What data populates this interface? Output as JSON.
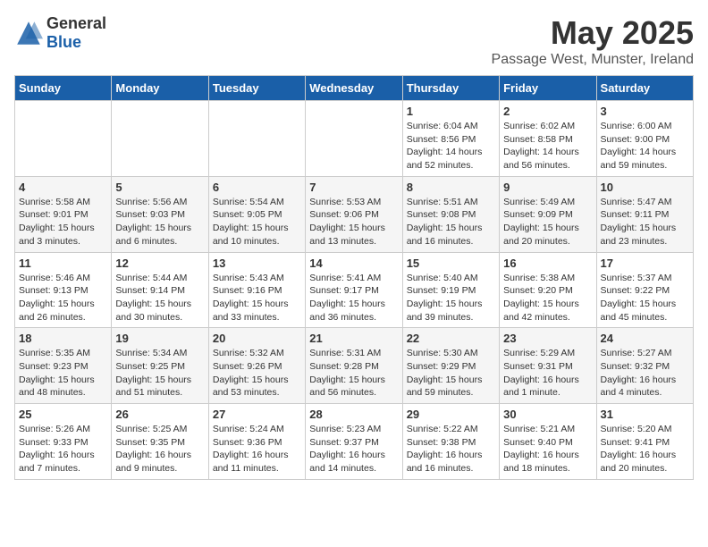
{
  "logo": {
    "general": "General",
    "blue": "Blue"
  },
  "title": "May 2025",
  "location": "Passage West, Munster, Ireland",
  "days_of_week": [
    "Sunday",
    "Monday",
    "Tuesday",
    "Wednesday",
    "Thursday",
    "Friday",
    "Saturday"
  ],
  "weeks": [
    [
      {
        "day": "",
        "info": ""
      },
      {
        "day": "",
        "info": ""
      },
      {
        "day": "",
        "info": ""
      },
      {
        "day": "",
        "info": ""
      },
      {
        "day": "1",
        "info": "Sunrise: 6:04 AM\nSunset: 8:56 PM\nDaylight: 14 hours\nand 52 minutes."
      },
      {
        "day": "2",
        "info": "Sunrise: 6:02 AM\nSunset: 8:58 PM\nDaylight: 14 hours\nand 56 minutes."
      },
      {
        "day": "3",
        "info": "Sunrise: 6:00 AM\nSunset: 9:00 PM\nDaylight: 14 hours\nand 59 minutes."
      }
    ],
    [
      {
        "day": "4",
        "info": "Sunrise: 5:58 AM\nSunset: 9:01 PM\nDaylight: 15 hours\nand 3 minutes."
      },
      {
        "day": "5",
        "info": "Sunrise: 5:56 AM\nSunset: 9:03 PM\nDaylight: 15 hours\nand 6 minutes."
      },
      {
        "day": "6",
        "info": "Sunrise: 5:54 AM\nSunset: 9:05 PM\nDaylight: 15 hours\nand 10 minutes."
      },
      {
        "day": "7",
        "info": "Sunrise: 5:53 AM\nSunset: 9:06 PM\nDaylight: 15 hours\nand 13 minutes."
      },
      {
        "day": "8",
        "info": "Sunrise: 5:51 AM\nSunset: 9:08 PM\nDaylight: 15 hours\nand 16 minutes."
      },
      {
        "day": "9",
        "info": "Sunrise: 5:49 AM\nSunset: 9:09 PM\nDaylight: 15 hours\nand 20 minutes."
      },
      {
        "day": "10",
        "info": "Sunrise: 5:47 AM\nSunset: 9:11 PM\nDaylight: 15 hours\nand 23 minutes."
      }
    ],
    [
      {
        "day": "11",
        "info": "Sunrise: 5:46 AM\nSunset: 9:13 PM\nDaylight: 15 hours\nand 26 minutes."
      },
      {
        "day": "12",
        "info": "Sunrise: 5:44 AM\nSunset: 9:14 PM\nDaylight: 15 hours\nand 30 minutes."
      },
      {
        "day": "13",
        "info": "Sunrise: 5:43 AM\nSunset: 9:16 PM\nDaylight: 15 hours\nand 33 minutes."
      },
      {
        "day": "14",
        "info": "Sunrise: 5:41 AM\nSunset: 9:17 PM\nDaylight: 15 hours\nand 36 minutes."
      },
      {
        "day": "15",
        "info": "Sunrise: 5:40 AM\nSunset: 9:19 PM\nDaylight: 15 hours\nand 39 minutes."
      },
      {
        "day": "16",
        "info": "Sunrise: 5:38 AM\nSunset: 9:20 PM\nDaylight: 15 hours\nand 42 minutes."
      },
      {
        "day": "17",
        "info": "Sunrise: 5:37 AM\nSunset: 9:22 PM\nDaylight: 15 hours\nand 45 minutes."
      }
    ],
    [
      {
        "day": "18",
        "info": "Sunrise: 5:35 AM\nSunset: 9:23 PM\nDaylight: 15 hours\nand 48 minutes."
      },
      {
        "day": "19",
        "info": "Sunrise: 5:34 AM\nSunset: 9:25 PM\nDaylight: 15 hours\nand 51 minutes."
      },
      {
        "day": "20",
        "info": "Sunrise: 5:32 AM\nSunset: 9:26 PM\nDaylight: 15 hours\nand 53 minutes."
      },
      {
        "day": "21",
        "info": "Sunrise: 5:31 AM\nSunset: 9:28 PM\nDaylight: 15 hours\nand 56 minutes."
      },
      {
        "day": "22",
        "info": "Sunrise: 5:30 AM\nSunset: 9:29 PM\nDaylight: 15 hours\nand 59 minutes."
      },
      {
        "day": "23",
        "info": "Sunrise: 5:29 AM\nSunset: 9:31 PM\nDaylight: 16 hours\nand 1 minute."
      },
      {
        "day": "24",
        "info": "Sunrise: 5:27 AM\nSunset: 9:32 PM\nDaylight: 16 hours\nand 4 minutes."
      }
    ],
    [
      {
        "day": "25",
        "info": "Sunrise: 5:26 AM\nSunset: 9:33 PM\nDaylight: 16 hours\nand 7 minutes."
      },
      {
        "day": "26",
        "info": "Sunrise: 5:25 AM\nSunset: 9:35 PM\nDaylight: 16 hours\nand 9 minutes."
      },
      {
        "day": "27",
        "info": "Sunrise: 5:24 AM\nSunset: 9:36 PM\nDaylight: 16 hours\nand 11 minutes."
      },
      {
        "day": "28",
        "info": "Sunrise: 5:23 AM\nSunset: 9:37 PM\nDaylight: 16 hours\nand 14 minutes."
      },
      {
        "day": "29",
        "info": "Sunrise: 5:22 AM\nSunset: 9:38 PM\nDaylight: 16 hours\nand 16 minutes."
      },
      {
        "day": "30",
        "info": "Sunrise: 5:21 AM\nSunset: 9:40 PM\nDaylight: 16 hours\nand 18 minutes."
      },
      {
        "day": "31",
        "info": "Sunrise: 5:20 AM\nSunset: 9:41 PM\nDaylight: 16 hours\nand 20 minutes."
      }
    ]
  ]
}
